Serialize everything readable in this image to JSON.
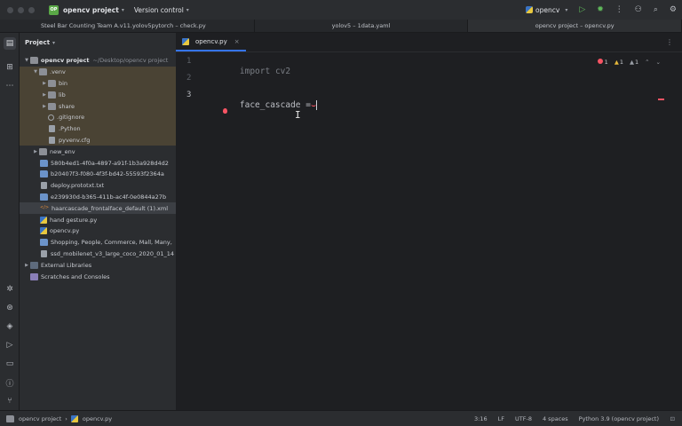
{
  "titlebar": {
    "project_badge": "OP",
    "project_name": "opencv project",
    "version_control": "Version control",
    "run_config": "opencv",
    "icons": [
      "run-icon",
      "debug-icon",
      "more-icon",
      "account-icon",
      "search-icon",
      "settings-icon"
    ]
  },
  "window_tabs": [
    "Steel Bar Counting Team A.v11.yolov5pytorch – check.py",
    "yolov5 – 1data.yaml",
    "opencv project – opencv.py"
  ],
  "project_panel": {
    "title": "Project",
    "root_name": "opencv project",
    "root_path": "~/Desktop/opencv project",
    "items": [
      {
        "label": ".venv",
        "kind": "folder"
      },
      {
        "label": "bin",
        "kind": "folder"
      },
      {
        "label": "lib",
        "kind": "folder"
      },
      {
        "label": "share",
        "kind": "folder"
      },
      {
        "label": ".gitignore",
        "kind": "git"
      },
      {
        "label": ".Python",
        "kind": "file"
      },
      {
        "label": "pyvenv.cfg",
        "kind": "file"
      },
      {
        "label": "new_env",
        "kind": "folder"
      },
      {
        "label": "580b4ed1-4f0a-4897-a91f-1b3a928d4d2",
        "kind": "image"
      },
      {
        "label": "b20407f3-f080-4f3f-bd42-55593f2364a",
        "kind": "image"
      },
      {
        "label": "deploy.prototxt.txt",
        "kind": "file"
      },
      {
        "label": "e239930d-b365-411b-ac4f-0e0844a27b",
        "kind": "image"
      },
      {
        "label": "haarcascade_frontalface_default (1).xml",
        "kind": "xml"
      },
      {
        "label": "hand gesture.py",
        "kind": "py"
      },
      {
        "label": "opencv.py",
        "kind": "py"
      },
      {
        "label": "Shopping, People, Commerce, Mall, Many,",
        "kind": "image"
      },
      {
        "label": "ssd_mobilenet_v3_large_coco_2020_01_14",
        "kind": "file"
      },
      {
        "label": "External Libraries",
        "kind": "lib"
      },
      {
        "label": "Scratches and Consoles",
        "kind": "scratch"
      }
    ]
  },
  "editor": {
    "tab_label": "opencv.py",
    "line_numbers": [
      "1",
      "2",
      "3"
    ],
    "code": {
      "line1_kw": "import",
      "line1_mod": "cv2",
      "line3_var": "face_cascade",
      "line3_op": "="
    },
    "inspections": {
      "errors": "1",
      "warnings": "1",
      "weak": "1"
    }
  },
  "statusbar": {
    "breadcrumb_project": "opencv project",
    "breadcrumb_file": "opencv.py",
    "position": "3:16",
    "line_sep": "LF",
    "encoding": "UTF-8",
    "indent": "4 spaces",
    "interpreter": "Python 3.9 (opencv project)"
  }
}
